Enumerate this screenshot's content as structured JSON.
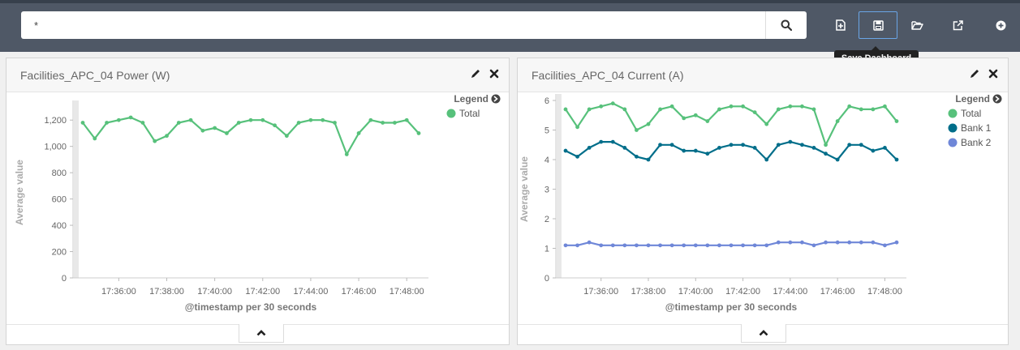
{
  "search": {
    "query": "*"
  },
  "toolbar": {
    "new_icon": "new-dashboard-icon",
    "save_icon": "save-icon",
    "open_icon": "folder-open-icon",
    "share_icon": "share-icon",
    "options_icon": "plus-circle-icon",
    "tooltip": "Save Dashboard"
  },
  "panels": [
    {
      "title": "Facilities_APC_04 Power (W)"
    },
    {
      "title": "Facilities_APC_04 Current (A)"
    }
  ],
  "chart_data": [
    {
      "type": "line",
      "title": "Facilities_APC_04 Power (W)",
      "xlabel": "@timestamp per 30 seconds",
      "ylabel": "Average value",
      "ylim": [
        0,
        1300
      ],
      "yticks": [
        "0",
        "200",
        "400",
        "600",
        "800",
        "1,000",
        "1,200"
      ],
      "xticks": [
        "17:36:00",
        "17:38:00",
        "17:40:00",
        "17:42:00",
        "17:44:00",
        "17:46:00",
        "17:48:00"
      ],
      "x_start": "17:34:30",
      "x_step_seconds": 30,
      "legend_title": "Legend",
      "series": [
        {
          "name": "Total",
          "color": "#57c17b",
          "values": [
            1180,
            1060,
            1180,
            1200,
            1220,
            1180,
            1040,
            1080,
            1180,
            1200,
            1120,
            1140,
            1100,
            1180,
            1200,
            1200,
            1160,
            1080,
            1180,
            1200,
            1200,
            1180,
            940,
            1100,
            1200,
            1180,
            1180,
            1200,
            1100
          ]
        }
      ]
    },
    {
      "type": "line",
      "title": "Facilities_APC_04 Current (A)",
      "xlabel": "@timestamp per 30 seconds",
      "ylabel": "Average value",
      "ylim": [
        0,
        6
      ],
      "yticks": [
        "0",
        "1",
        "2",
        "3",
        "4",
        "5",
        "6"
      ],
      "xticks": [
        "17:36:00",
        "17:38:00",
        "17:40:00",
        "17:42:00",
        "17:44:00",
        "17:46:00",
        "17:48:00"
      ],
      "x_start": "17:34:30",
      "x_step_seconds": 30,
      "legend_title": "Legend",
      "series": [
        {
          "name": "Total",
          "color": "#57c17b",
          "values": [
            5.7,
            5.1,
            5.7,
            5.8,
            5.9,
            5.7,
            5.0,
            5.2,
            5.7,
            5.8,
            5.4,
            5.5,
            5.3,
            5.7,
            5.8,
            5.8,
            5.6,
            5.2,
            5.7,
            5.8,
            5.8,
            5.7,
            4.5,
            5.3,
            5.8,
            5.7,
            5.7,
            5.8,
            5.3
          ]
        },
        {
          "name": "Bank 1",
          "color": "#006e8a",
          "values": [
            4.3,
            4.1,
            4.4,
            4.6,
            4.6,
            4.4,
            4.1,
            4.0,
            4.5,
            4.5,
            4.3,
            4.3,
            4.2,
            4.4,
            4.5,
            4.5,
            4.4,
            4.0,
            4.5,
            4.6,
            4.5,
            4.4,
            4.2,
            4.0,
            4.5,
            4.5,
            4.3,
            4.4,
            4.0
          ]
        },
        {
          "name": "Bank 2",
          "color": "#6f87d8",
          "values": [
            1.1,
            1.1,
            1.2,
            1.1,
            1.1,
            1.1,
            1.1,
            1.1,
            1.1,
            1.1,
            1.1,
            1.1,
            1.1,
            1.1,
            1.1,
            1.1,
            1.1,
            1.1,
            1.2,
            1.2,
            1.2,
            1.1,
            1.2,
            1.2,
            1.2,
            1.2,
            1.2,
            1.1,
            1.2
          ]
        }
      ]
    }
  ]
}
